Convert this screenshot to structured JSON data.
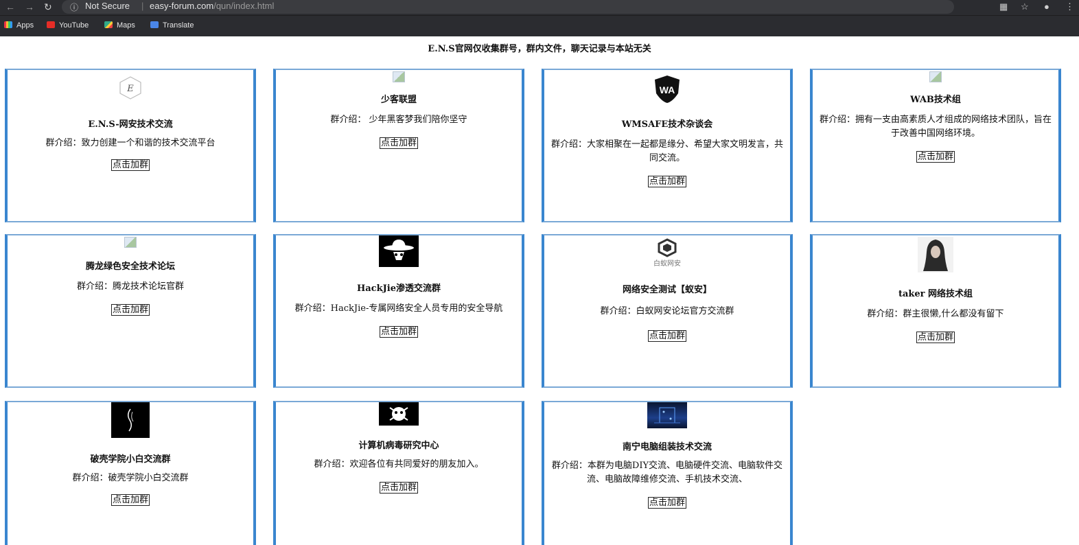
{
  "browser": {
    "security": "Not Secure",
    "url_host": "easy-forum.com",
    "url_path": "/qun/index.html",
    "bookmarks": [
      "Apps",
      "YouTube",
      "Maps",
      "Translate"
    ]
  },
  "page": {
    "title": "E.N.S官网仅收集群号，群内文件，聊天记录与本站无关"
  },
  "join_label": "点击加群",
  "cards": [
    {
      "name": "E.N.S-网安技术交流",
      "desc": "群介绍：致力创建一个和谐的技术交流平台",
      "logo": "hexagon-logo",
      "logo_text": "E"
    },
    {
      "name": "少客联盟",
      "desc": "群介绍： 少年黑客梦我们陪你坚守",
      "logo": "broken-image"
    },
    {
      "name": "WMSAFE技术杂谈会",
      "desc": "群介绍：大家相聚在一起都是缘分、希望大家文明发言，共同交流。",
      "logo": "shield-logo",
      "logo_text": "WA"
    },
    {
      "name": "WAB技术组",
      "desc": "群介绍：拥有一支由高素质人才组成的网络技术团队，旨在于改善中国网络环境。",
      "logo": "broken-image"
    },
    {
      "name": "腾龙绿色安全技术论坛",
      "desc": "群介绍：腾龙技术论坛官群",
      "logo": "broken-image"
    },
    {
      "name": "HackJie渗透交流群",
      "desc": "群介绍：HackJie-专属网络安全人员专用的安全导航",
      "logo": "hacker-hat-logo"
    },
    {
      "name": "网络安全测试【蚁安】",
      "desc": "群介绍：白蚁网安论坛官方交流群",
      "logo": "baiyi-logo",
      "logo_text": "白蚁网安"
    },
    {
      "name": "taker 网络技术组",
      "desc": "群介绍：群主很懒,什么都没有留下",
      "logo": "avatar-portrait"
    },
    {
      "name": "破壳学院小白交流群",
      "desc": "群介绍：破壳学院小白交流群",
      "logo": "flame-logo"
    },
    {
      "name": "计算机病毒研究中心",
      "desc": "群介绍：欢迎各位有共同爱好的朋友加入。",
      "logo": "virus-logo"
    },
    {
      "name": "南宁电脑组装技术交流",
      "desc": "群介绍：本群为电脑DIY交流、电脑硬件交流、电脑软件交流、电脑故障维修交流、手机技术交流、",
      "logo": "computer-photo"
    }
  ]
}
